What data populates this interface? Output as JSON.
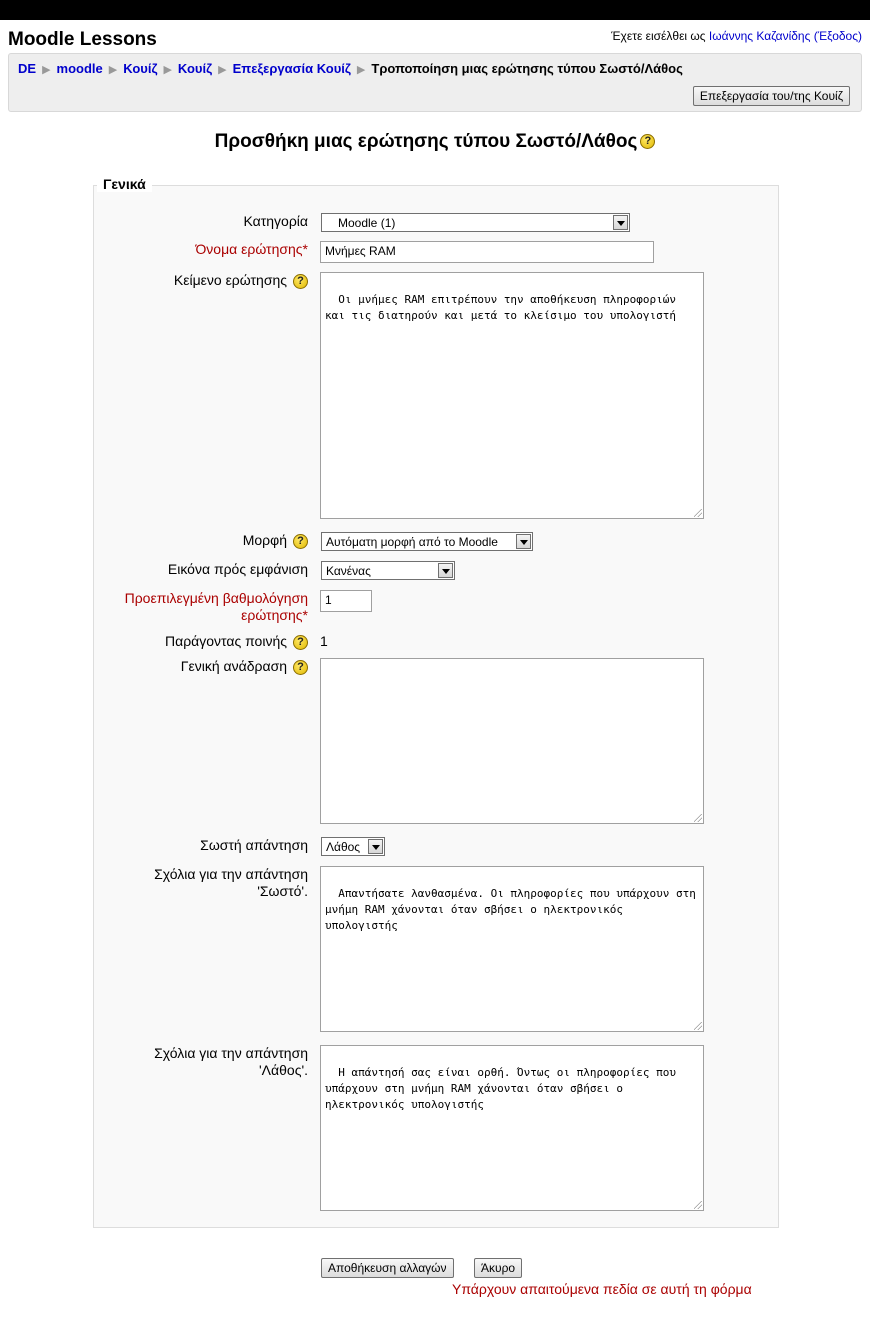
{
  "header": {
    "site_title": "Moodle Lessons",
    "login_prefix": "Έχετε εισέλθει ως",
    "user_name": "Ιωάννης Καζανίδης",
    "logout_label": "(Έξοδος)"
  },
  "breadcrumb": {
    "items": [
      "DE",
      "moodle",
      "Κουίζ",
      "Κουίζ",
      "Επεξεργασία Κουίζ"
    ],
    "current": "Τροποποίηση μιας ερώτησης τύπου Σωστό/Λάθος"
  },
  "navbar": {
    "edit_quiz_button": "Επεξεργασία του/της Κουίζ"
  },
  "page": {
    "heading": "Προσθήκη μιας ερώτησης τύπου Σωστό/Λάθος"
  },
  "form": {
    "legend": "Γενικά",
    "category": {
      "label": "Κατηγορία",
      "value": "Moodle (1)"
    },
    "question_name": {
      "label": "Όνομα ερώτησης*",
      "value": "Μνήμες RAM"
    },
    "question_text": {
      "label": "Κείμενο ερώτησης",
      "value": "Οι μνήμες RAM επιτρέπουν την αποθήκευση πληροφοριών και τις διατηρούν και μετά το κλείσιμο του υπολογιστή"
    },
    "format": {
      "label": "Μορφή",
      "value": "Αυτόματη μορφή από το Moodle"
    },
    "image": {
      "label": "Εικόνα πρός εμφάνιση",
      "value": "Κανένας"
    },
    "default_grade": {
      "label_line1": "Προεπιλεγμένη βαθμολόγηση",
      "label_line2": "ερώτησης*",
      "value": "1"
    },
    "penalty": {
      "label": "Παράγοντας ποινής",
      "value": "1"
    },
    "general_feedback": {
      "label": "Γενική ανάδραση",
      "value": ""
    },
    "correct_answer": {
      "label": "Σωστή απάντηση",
      "value": "Λάθος"
    },
    "feedback_true": {
      "label_line1": "Σχόλια για την απάντηση",
      "label_line2": "'Σωστό'.",
      "value": "Απαντήσατε λανθασμένα. Οι πληροφορίες που υπάρχουν στη μνήμη RAM χάνονται όταν σβήσει ο ηλεκτρονικός υπολογιστής"
    },
    "feedback_false": {
      "label_line1": "Σχόλια για την απάντηση",
      "label_line2": "'Λάθος'.",
      "value": "Η απάντησή σας είναι ορθή. Όντως οι πληροφορίες που υπάρχουν στη μνήμη RAM χάνονται όταν σβήσει ο ηλεκτρονικός υπολογιστής"
    },
    "help_symbol": "?"
  },
  "actions": {
    "save": "Αποθήκευση αλλαγών",
    "cancel": "Άκυρο",
    "required_note": "Υπάρχουν απαιτούμενα πεδία σε αυτή τη φόρμα"
  }
}
